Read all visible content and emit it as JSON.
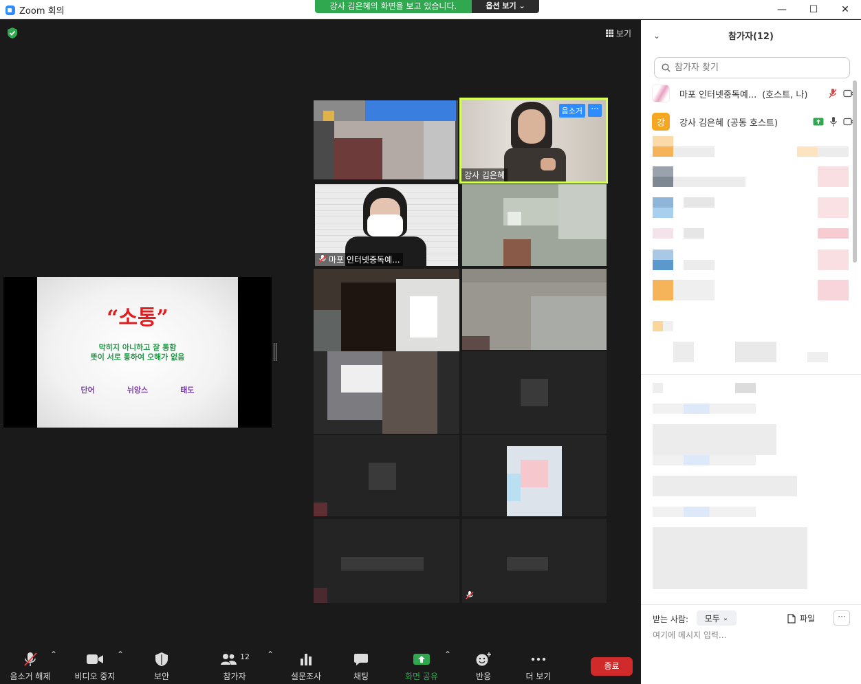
{
  "window": {
    "title": "Zoom 회의",
    "minimize": "—",
    "maximize": "☐",
    "close": "✕"
  },
  "share_banner": {
    "text": "강사 김은혜의 화면을 보고 있습니다.",
    "options": "옵션 보기 ⌄"
  },
  "view": {
    "label": "보기"
  },
  "slide": {
    "title": "“소통”",
    "line1": "막히지 아니하고 잘 통함",
    "line2": "뜻이 서로 통하여 오해가 없음",
    "keywords": [
      "단어",
      "뉘앙스",
      "태도"
    ]
  },
  "video_tiles": {
    "speaker": {
      "name": "강사 김은혜",
      "unmute_label": "음소거",
      "more_label": "···"
    },
    "self": {
      "name": "마포 인터넷중독예..."
    }
  },
  "toolbar": {
    "unmute": "음소거 해제",
    "stop_video": "비디오 중지",
    "security": "보안",
    "participants": "참가자",
    "participant_count": "12",
    "polls": "설문조사",
    "chat": "채팅",
    "share_screen": "화면 공유",
    "reactions": "반응",
    "more": "더 보기",
    "end": "종료"
  },
  "panel": {
    "title": "참가자(12)",
    "search_placeholder": "참가자 찾기",
    "participants": [
      {
        "name": "마포 인터넷중독예...",
        "role": "(호스트, 나)"
      },
      {
        "name": "강사 김은혜",
        "role": "(공동 호스트)",
        "avatar_letter": "강",
        "avatar_color": "#f5a623"
      }
    ]
  },
  "chat": {
    "to_label": "받는 사람:",
    "to_value": "모두",
    "file": "파일",
    "more": "···",
    "placeholder": "여기에 메시지 입력..."
  },
  "colors": {
    "accent": "#2D8CFF",
    "share_green": "#2fa84f",
    "end_red": "#d12a2a",
    "speaker_border": "#d7ff5a"
  }
}
